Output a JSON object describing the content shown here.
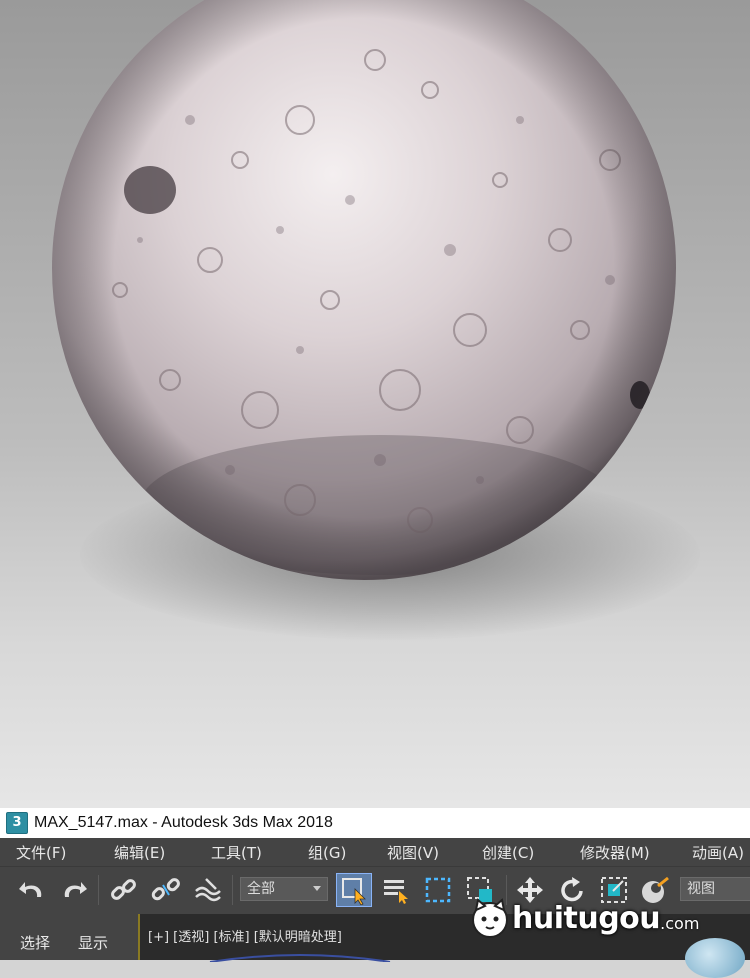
{
  "window": {
    "title": "MAX_5147.max - Autodesk 3ds Max 2018",
    "app_icon_text": "3"
  },
  "menu": {
    "items": [
      {
        "label": "文件(F)"
      },
      {
        "label": "编辑(E)"
      },
      {
        "label": "工具(T)"
      },
      {
        "label": "组(G)"
      },
      {
        "label": "视图(V)"
      },
      {
        "label": "创建(C)"
      },
      {
        "label": "修改器(M)"
      },
      {
        "label": "动画(A)"
      }
    ]
  },
  "toolbar": {
    "selection_filter": "全部",
    "reference_coord": "视图",
    "icons": [
      "undo-icon",
      "redo-icon",
      "link-icon",
      "unlink-icon",
      "bind-spacewarp-icon",
      "select-object-icon",
      "select-by-name-icon",
      "rect-selection-icon",
      "window-crossing-icon",
      "move-icon",
      "rotate-icon",
      "scale-icon",
      "placement-icon"
    ]
  },
  "sidebar": {
    "tabs": [
      {
        "label": "选择"
      },
      {
        "label": "显示"
      }
    ]
  },
  "viewport": {
    "label": "[+] [透视] [标准] [默认明暗处理]"
  },
  "watermark": {
    "text": "huitugou",
    "suffix": ".com"
  },
  "colors": {
    "menubar_bg": "#444444",
    "accent_blue": "#4db8ff",
    "selected_frame": "#8ab4f8"
  }
}
